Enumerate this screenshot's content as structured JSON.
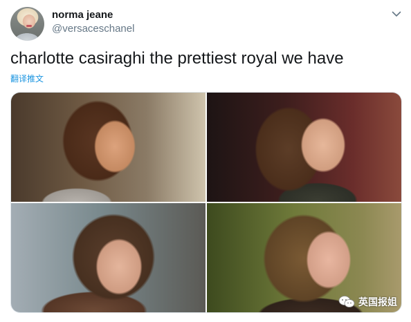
{
  "tweet": {
    "display_name": "norma jeane",
    "handle": "@versaceschanel",
    "text": "charlotte casiraghi the prettiest royal we have",
    "translate_label": "翻译推文",
    "avatar_icon": "profile-avatar"
  },
  "media": {
    "photos": [
      {
        "icon": "photo-portrait"
      },
      {
        "icon": "photo-portrait"
      },
      {
        "icon": "photo-portrait"
      },
      {
        "icon": "photo-portrait"
      }
    ]
  },
  "watermark": {
    "text": "英国报姐",
    "icon": "wechat-icon"
  },
  "colors": {
    "text_primary": "#14171a",
    "text_secondary": "#657786",
    "link": "#1b95e0",
    "border": "#e1e8ed"
  }
}
